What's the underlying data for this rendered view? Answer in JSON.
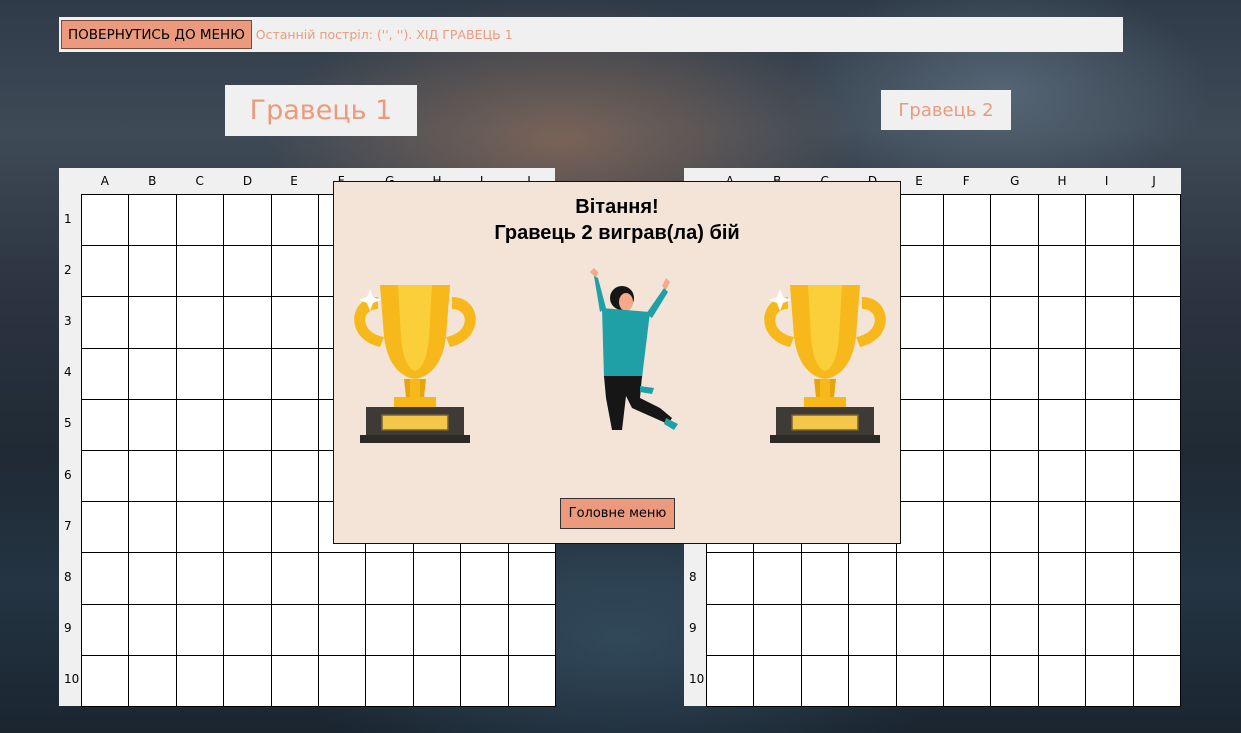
{
  "topbar": {
    "back_label": "ПОВЕРНУТИСЬ ДО МЕНЮ",
    "status": "Останній постріл: ('', '').  ХІД ГРАВЕЦЬ 1"
  },
  "players": {
    "p1": "Гравець 1",
    "p2": "Гравець 2"
  },
  "grid": {
    "columns": [
      "A",
      "B",
      "C",
      "D",
      "E",
      "F",
      "G",
      "H",
      "I",
      "J"
    ],
    "rows": [
      "1",
      "2",
      "3",
      "4",
      "5",
      "6",
      "7",
      "8",
      "9",
      "10"
    ]
  },
  "modal": {
    "title_line1": "Вітання!",
    "title_line2": "Гравець 2 виграв(ла) бій",
    "main_menu_label": "Головне меню"
  },
  "icons": {
    "trophy": "trophy-icon",
    "person": "jumping-person-icon"
  },
  "colors": {
    "accent": "#ec9a7e",
    "modal_bg": "#f4e4d7",
    "panel": "#f0f0f0"
  }
}
